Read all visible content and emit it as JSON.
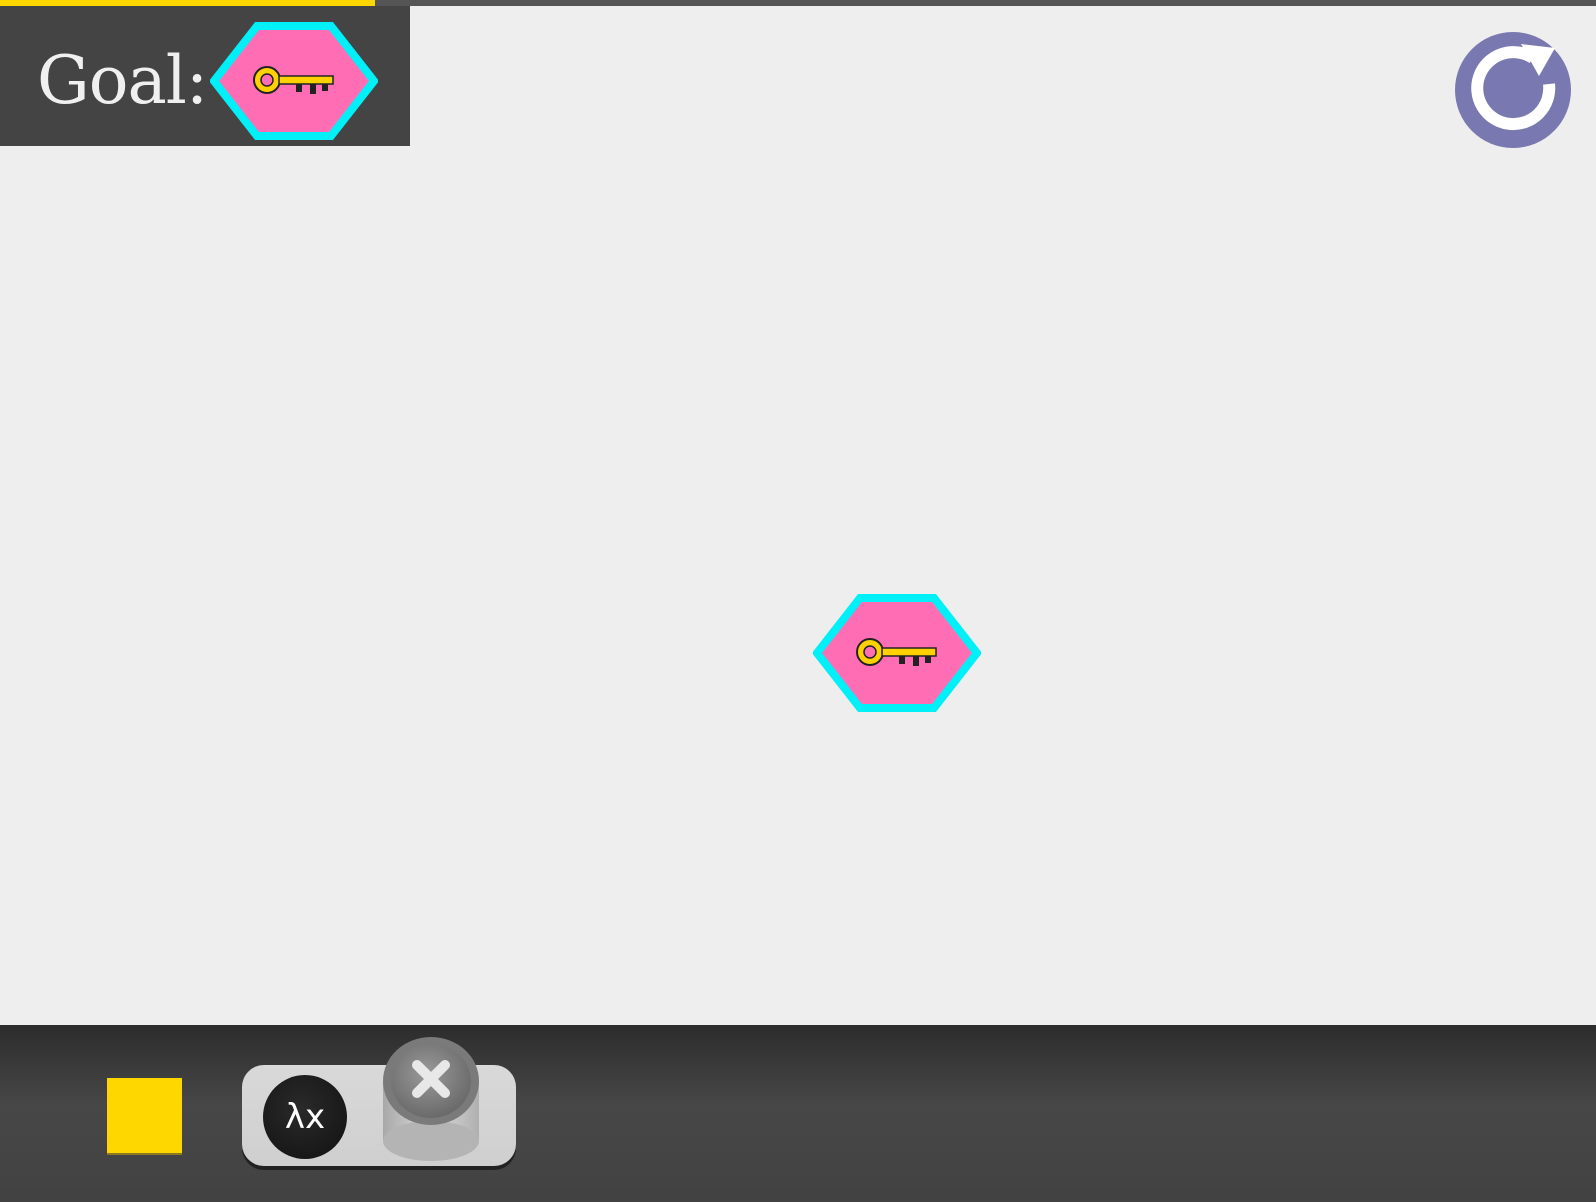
{
  "level_progress": 0.235,
  "goal": {
    "label": "Goal:",
    "item_icon": "key-icon"
  },
  "board": {
    "item_icon": "key-icon"
  },
  "reset": {
    "icon": "reset-icon"
  },
  "toolbox": {
    "square_block": {
      "icon": "square-icon"
    },
    "lambda_block": {
      "lambda_label": "λx",
      "variable_icon": "x-pipe-icon"
    }
  },
  "colors": {
    "hex_fill": "#ff6eb4",
    "hex_border": "#00f0f8",
    "key": "#ffd100",
    "square": "#ffd700",
    "reset": "#7a78b0",
    "progress": "#ffd700",
    "panel": "#444444",
    "background": "#eeeeee"
  }
}
